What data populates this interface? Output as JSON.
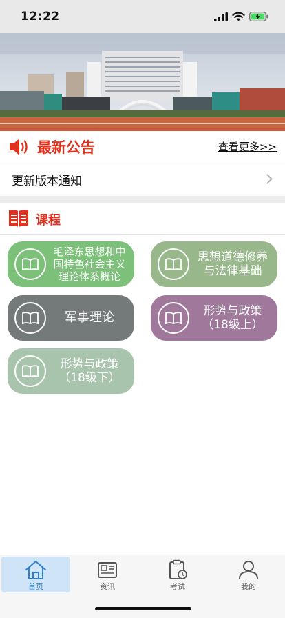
{
  "status_bar": {
    "time": "12:22"
  },
  "notice": {
    "title": "最新公告",
    "more_label": "查看更多>>",
    "items": [
      {
        "label": "更新版本通知"
      }
    ]
  },
  "courses": {
    "title": "课程",
    "items": [
      {
        "label": "毛泽东思想和中\n国特色社会主义\n理论体系概论",
        "color": "#7cc07a"
      },
      {
        "label": "思想道德修养\n与法律基础",
        "color": "#98b88c"
      },
      {
        "label": "军事理论",
        "color": "#747a7a"
      },
      {
        "label": "形势与政策\n（18级上）",
        "color": "#a0789c"
      },
      {
        "label": "形势与政策\n（18级下）",
        "color": "#a9c4ad"
      }
    ]
  },
  "tabs": [
    {
      "label": "首页",
      "icon": "home-icon",
      "active": true
    },
    {
      "label": "资讯",
      "icon": "newspaper-icon",
      "active": false
    },
    {
      "label": "考试",
      "icon": "clipboard-clock-icon",
      "active": false
    },
    {
      "label": "我的",
      "icon": "person-icon",
      "active": false
    }
  ],
  "colors": {
    "accent_red": "#e1321f",
    "tab_active": "#2f7fd0"
  }
}
